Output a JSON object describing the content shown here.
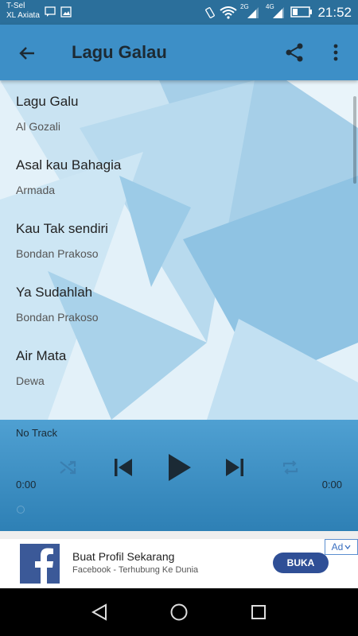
{
  "status_bar": {
    "carrier_line1": "T-Sel",
    "carrier_line2": "XL Axiata",
    "network_labels": [
      "2G",
      "4G"
    ],
    "time": "21:52",
    "icons": [
      "chat-icon",
      "gallery-icon",
      "vibrate-icon",
      "wifi-icon",
      "signal-icon",
      "signal-icon",
      "battery-icon"
    ]
  },
  "app_bar": {
    "title": "Lagu Galau",
    "back_icon": "arrow-back-icon",
    "share_icon": "share-icon",
    "more_icon": "more-vert-icon",
    "color": "#3d8fc7"
  },
  "tracks": [
    {
      "title": "Lagu Galu",
      "artist": "Al Gozali"
    },
    {
      "title": "Asal kau Bahagia",
      "artist": "Armada"
    },
    {
      "title": "Kau Tak sendiri",
      "artist": "Bondan Prakoso"
    },
    {
      "title": "Ya Sudahlah",
      "artist": "Bondan Prakoso"
    },
    {
      "title": "Air Mata",
      "artist": "Dewa"
    }
  ],
  "player": {
    "now_playing": "No Track",
    "elapsed": "0:00",
    "duration": "0:00",
    "progress": 0,
    "controls": [
      "shuffle-icon",
      "skip-previous-icon",
      "play-icon",
      "skip-next-icon",
      "repeat-icon"
    ]
  },
  "ad": {
    "title": "Buat Profil Sekarang",
    "subtitle": "Facebook - Terhubung Ke Dunia",
    "button": "BUKA",
    "tag": "Ad",
    "logo": "facebook-logo-icon",
    "brand_color": "#3b5998"
  },
  "nav_bar": {
    "icons": [
      "back-triangle-icon",
      "home-circle-icon",
      "recents-square-icon"
    ]
  }
}
